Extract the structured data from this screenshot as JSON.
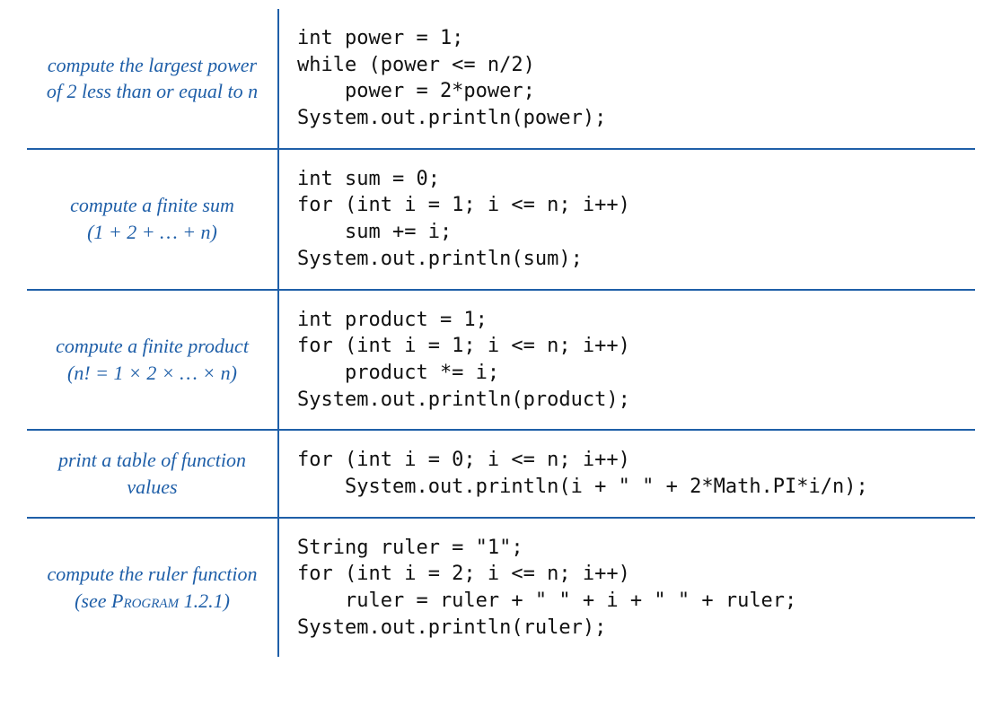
{
  "colors": {
    "accent": "#1f5fa8",
    "text": "#111111"
  },
  "rows": [
    {
      "desc_main": "compute the largest power of 2 less than or equal to n",
      "desc_sub": "",
      "code": "int power = 1;\nwhile (power <= n/2)\n    power = 2*power;\nSystem.out.println(power);"
    },
    {
      "desc_main": "compute a finite sum",
      "desc_sub": "(1 + 2 + … + n)",
      "code": "int sum = 0;\nfor (int i = 1; i <= n; i++)\n    sum += i;\nSystem.out.println(sum);"
    },
    {
      "desc_main": "compute a finite product",
      "desc_sub": "(n! = 1 × 2 ×  …  × n)",
      "code": "int product = 1;\nfor (int i = 1; i <= n; i++)\n    product *= i;\nSystem.out.println(product);"
    },
    {
      "desc_main": "print a table of function values",
      "desc_sub": "",
      "code": "for (int i = 0; i <= n; i++)\n    System.out.println(i + \" \" + 2*Math.PI*i/n);"
    },
    {
      "desc_main": "compute the ruler function",
      "desc_sub_prefix": "(see ",
      "desc_sub_program": "Program",
      "desc_sub_suffix": " 1.2.1)",
      "code": "String ruler = \"1\";\nfor (int i = 2; i <= n; i++)\n    ruler = ruler + \" \" + i + \" \" + ruler;\nSystem.out.println(ruler);"
    }
  ]
}
